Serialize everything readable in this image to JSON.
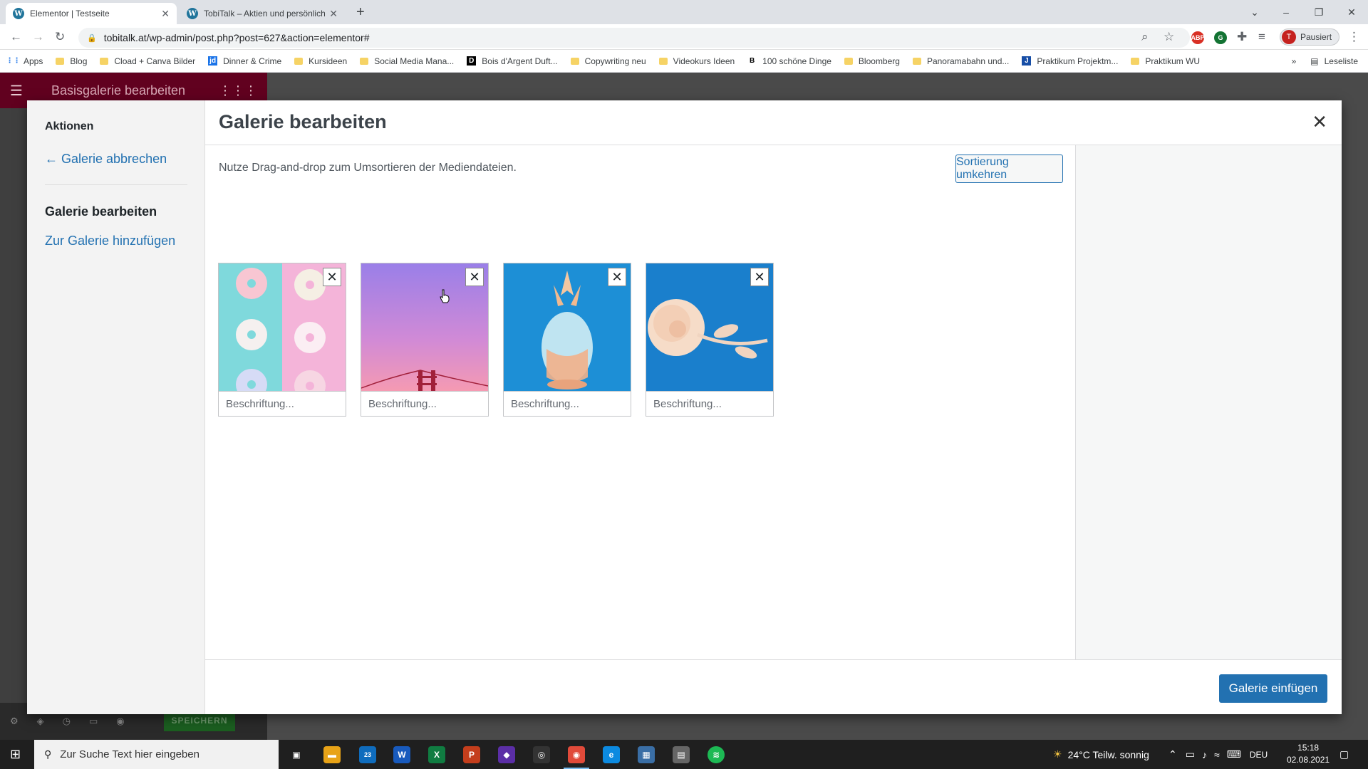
{
  "browser": {
    "tabs": [
      {
        "title": "Elementor | Testseite",
        "active": true
      },
      {
        "title": "TobiTalk – Aktien und persönlich",
        "active": false
      }
    ],
    "new_tab_icon": "plus-icon",
    "url": "tobitalk.at/wp-admin/post.php?post=627&action=elementor#",
    "profile_initial": "T",
    "profile_label": "Pausiert",
    "bookmarks": [
      {
        "label": "Apps",
        "icon": "apps-grid-icon"
      },
      {
        "label": "Blog",
        "icon": "folder-icon"
      },
      {
        "label": "Cload + Canva Bilder",
        "icon": "folder-icon"
      },
      {
        "label": "Dinner & Crime",
        "icon": "jd-icon"
      },
      {
        "label": "Kursideen",
        "icon": "folder-icon"
      },
      {
        "label": "Social Media Mana...",
        "icon": "folder-icon"
      },
      {
        "label": "Bois d'Argent Duft...",
        "icon": "bois-icon"
      },
      {
        "label": "Copywriting neu",
        "icon": "folder-icon"
      },
      {
        "label": "Videokurs Ideen",
        "icon": "folder-icon"
      },
      {
        "label": "100 schöne Dinge",
        "icon": "b-icon"
      },
      {
        "label": "Bloomberg",
        "icon": "folder-icon"
      },
      {
        "label": "Panoramabahn und...",
        "icon": "folder-icon"
      },
      {
        "label": "Praktikum Projektm...",
        "icon": "j-icon"
      },
      {
        "label": "Praktikum WU",
        "icon": "folder-icon"
      }
    ],
    "reading_list": "Leseliste"
  },
  "elementor": {
    "panel_title": "Basisgalerie bearbeiten",
    "save_label": "SPEICHERN"
  },
  "modal": {
    "sidebar": {
      "heading": "Aktionen",
      "cancel_link": "← Galerie abbrechen",
      "current": "Galerie bearbeiten",
      "add_link": "Zur Galerie hinzufügen"
    },
    "title": "Galerie bearbeiten",
    "help_text": "Nutze Drag-and-drop zum Umsortieren der Mediendateien.",
    "reverse_button": "Sortierung umkehren",
    "insert_button": "Galerie einfügen",
    "images": [
      {
        "name": "donuts",
        "caption_placeholder": "Beschriftung..."
      },
      {
        "name": "golden-gate-sunset",
        "caption_placeholder": "Beschriftung..."
      },
      {
        "name": "pineapple",
        "caption_placeholder": "Beschriftung..."
      },
      {
        "name": "rose",
        "caption_placeholder": "Beschriftung..."
      }
    ]
  },
  "taskbar": {
    "search_placeholder": "Zur Suche Text hier eingeben",
    "weather": "24°C  Teilw. sonnig",
    "language": "DEU",
    "time": "15:18",
    "date": "02.08.2021",
    "mail_badge": "23"
  }
}
